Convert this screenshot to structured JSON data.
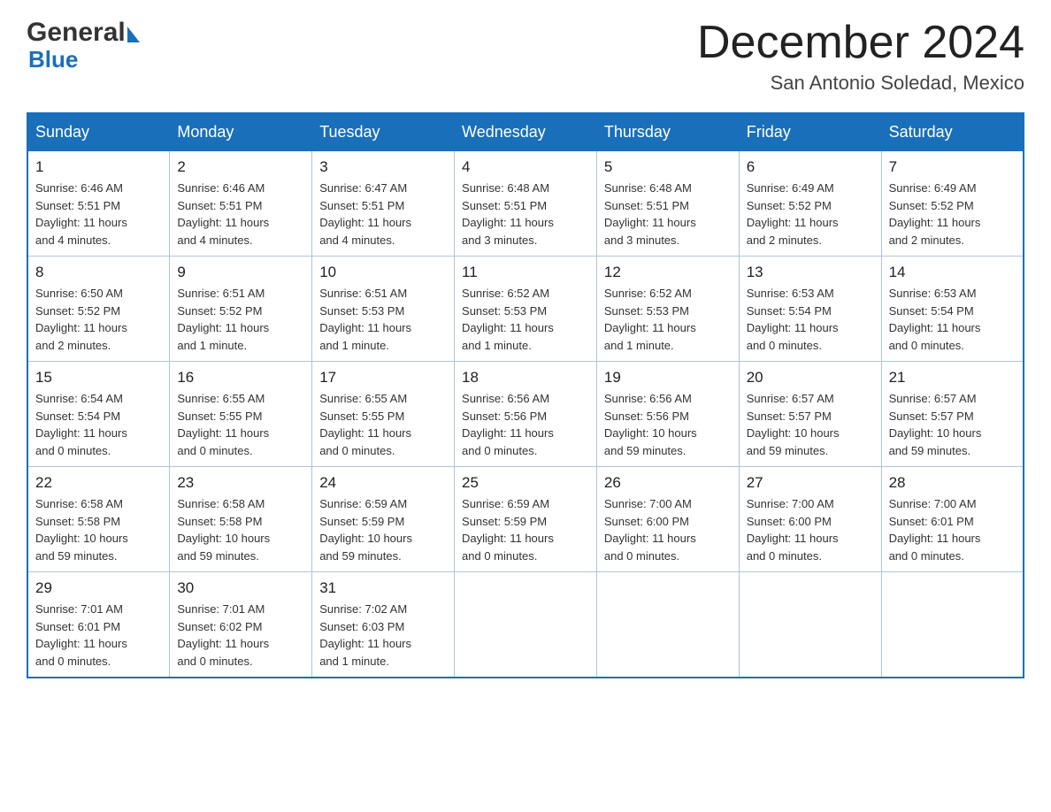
{
  "header": {
    "logo_general": "General",
    "logo_blue": "Blue",
    "month_title": "December 2024",
    "location": "San Antonio Soledad, Mexico"
  },
  "days_of_week": [
    "Sunday",
    "Monday",
    "Tuesday",
    "Wednesday",
    "Thursday",
    "Friday",
    "Saturday"
  ],
  "weeks": [
    [
      {
        "day": "1",
        "sunrise": "6:46 AM",
        "sunset": "5:51 PM",
        "daylight": "11 hours and 4 minutes."
      },
      {
        "day": "2",
        "sunrise": "6:46 AM",
        "sunset": "5:51 PM",
        "daylight": "11 hours and 4 minutes."
      },
      {
        "day": "3",
        "sunrise": "6:47 AM",
        "sunset": "5:51 PM",
        "daylight": "11 hours and 4 minutes."
      },
      {
        "day": "4",
        "sunrise": "6:48 AM",
        "sunset": "5:51 PM",
        "daylight": "11 hours and 3 minutes."
      },
      {
        "day": "5",
        "sunrise": "6:48 AM",
        "sunset": "5:51 PM",
        "daylight": "11 hours and 3 minutes."
      },
      {
        "day": "6",
        "sunrise": "6:49 AM",
        "sunset": "5:52 PM",
        "daylight": "11 hours and 2 minutes."
      },
      {
        "day": "7",
        "sunrise": "6:49 AM",
        "sunset": "5:52 PM",
        "daylight": "11 hours and 2 minutes."
      }
    ],
    [
      {
        "day": "8",
        "sunrise": "6:50 AM",
        "sunset": "5:52 PM",
        "daylight": "11 hours and 2 minutes."
      },
      {
        "day": "9",
        "sunrise": "6:51 AM",
        "sunset": "5:52 PM",
        "daylight": "11 hours and 1 minute."
      },
      {
        "day": "10",
        "sunrise": "6:51 AM",
        "sunset": "5:53 PM",
        "daylight": "11 hours and 1 minute."
      },
      {
        "day": "11",
        "sunrise": "6:52 AM",
        "sunset": "5:53 PM",
        "daylight": "11 hours and 1 minute."
      },
      {
        "day": "12",
        "sunrise": "6:52 AM",
        "sunset": "5:53 PM",
        "daylight": "11 hours and 1 minute."
      },
      {
        "day": "13",
        "sunrise": "6:53 AM",
        "sunset": "5:54 PM",
        "daylight": "11 hours and 0 minutes."
      },
      {
        "day": "14",
        "sunrise": "6:53 AM",
        "sunset": "5:54 PM",
        "daylight": "11 hours and 0 minutes."
      }
    ],
    [
      {
        "day": "15",
        "sunrise": "6:54 AM",
        "sunset": "5:54 PM",
        "daylight": "11 hours and 0 minutes."
      },
      {
        "day": "16",
        "sunrise": "6:55 AM",
        "sunset": "5:55 PM",
        "daylight": "11 hours and 0 minutes."
      },
      {
        "day": "17",
        "sunrise": "6:55 AM",
        "sunset": "5:55 PM",
        "daylight": "11 hours and 0 minutes."
      },
      {
        "day": "18",
        "sunrise": "6:56 AM",
        "sunset": "5:56 PM",
        "daylight": "11 hours and 0 minutes."
      },
      {
        "day": "19",
        "sunrise": "6:56 AM",
        "sunset": "5:56 PM",
        "daylight": "10 hours and 59 minutes."
      },
      {
        "day": "20",
        "sunrise": "6:57 AM",
        "sunset": "5:57 PM",
        "daylight": "10 hours and 59 minutes."
      },
      {
        "day": "21",
        "sunrise": "6:57 AM",
        "sunset": "5:57 PM",
        "daylight": "10 hours and 59 minutes."
      }
    ],
    [
      {
        "day": "22",
        "sunrise": "6:58 AM",
        "sunset": "5:58 PM",
        "daylight": "10 hours and 59 minutes."
      },
      {
        "day": "23",
        "sunrise": "6:58 AM",
        "sunset": "5:58 PM",
        "daylight": "10 hours and 59 minutes."
      },
      {
        "day": "24",
        "sunrise": "6:59 AM",
        "sunset": "5:59 PM",
        "daylight": "10 hours and 59 minutes."
      },
      {
        "day": "25",
        "sunrise": "6:59 AM",
        "sunset": "5:59 PM",
        "daylight": "11 hours and 0 minutes."
      },
      {
        "day": "26",
        "sunrise": "7:00 AM",
        "sunset": "6:00 PM",
        "daylight": "11 hours and 0 minutes."
      },
      {
        "day": "27",
        "sunrise": "7:00 AM",
        "sunset": "6:00 PM",
        "daylight": "11 hours and 0 minutes."
      },
      {
        "day": "28",
        "sunrise": "7:00 AM",
        "sunset": "6:01 PM",
        "daylight": "11 hours and 0 minutes."
      }
    ],
    [
      {
        "day": "29",
        "sunrise": "7:01 AM",
        "sunset": "6:01 PM",
        "daylight": "11 hours and 0 minutes."
      },
      {
        "day": "30",
        "sunrise": "7:01 AM",
        "sunset": "6:02 PM",
        "daylight": "11 hours and 0 minutes."
      },
      {
        "day": "31",
        "sunrise": "7:02 AM",
        "sunset": "6:03 PM",
        "daylight": "11 hours and 1 minute."
      },
      null,
      null,
      null,
      null
    ]
  ],
  "labels": {
    "sunrise": "Sunrise:",
    "sunset": "Sunset:",
    "daylight": "Daylight:"
  }
}
